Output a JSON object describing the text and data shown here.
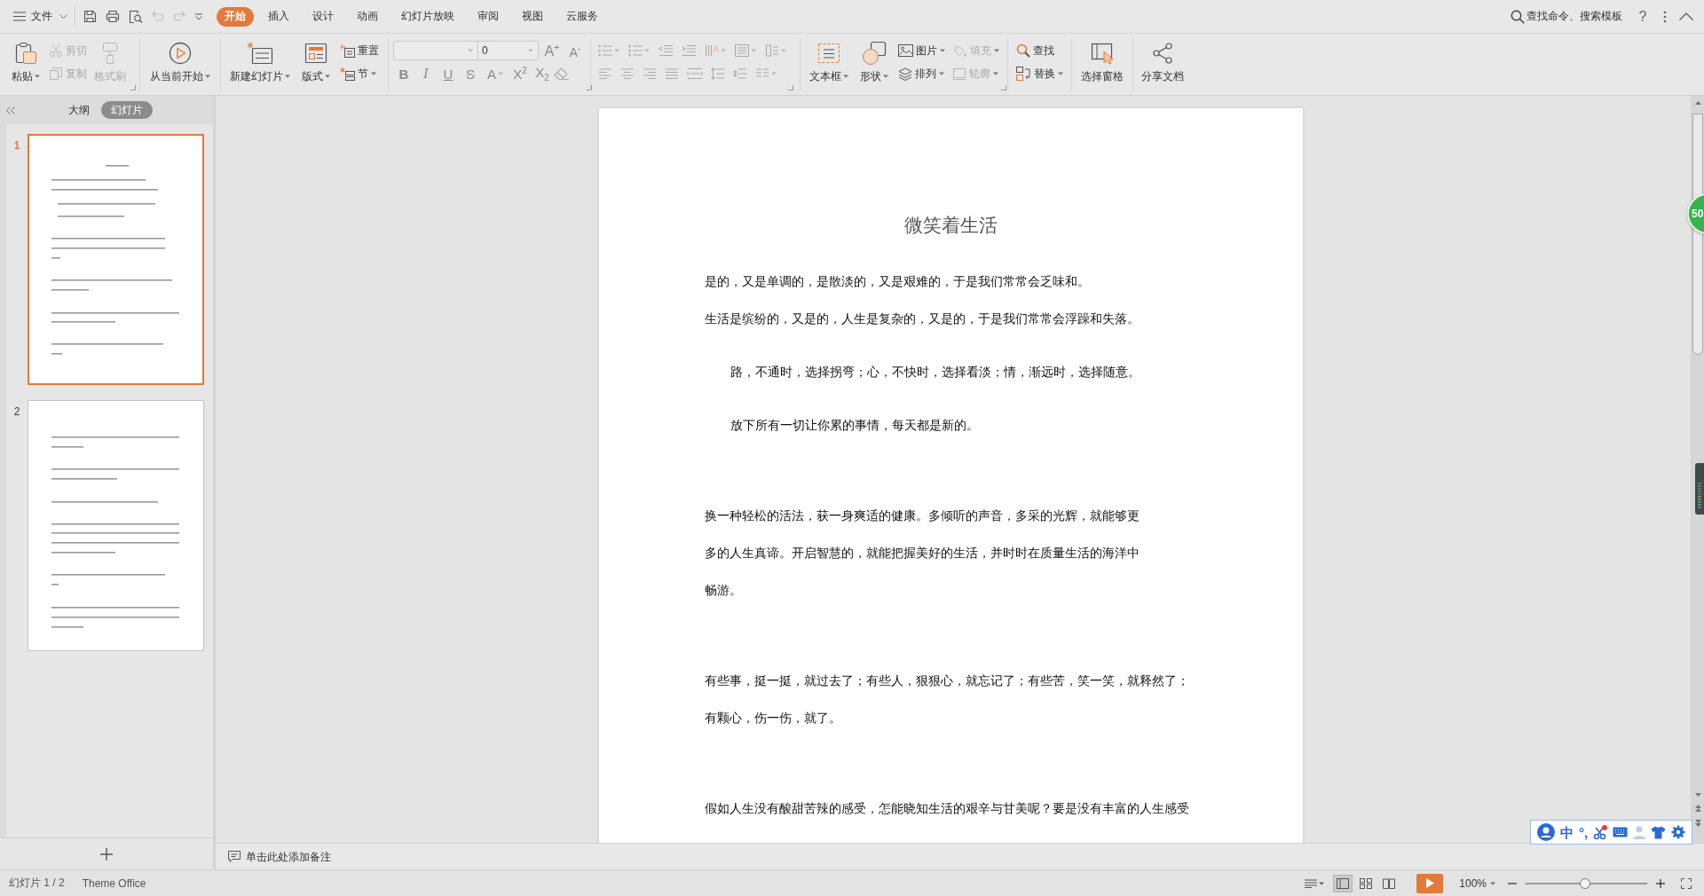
{
  "menu_bar": {
    "file_menu": "文件",
    "tabs": [
      {
        "label": "开始",
        "selected": true
      },
      {
        "label": "插入",
        "selected": false
      },
      {
        "label": "设计",
        "selected": false
      },
      {
        "label": "动画",
        "selected": false
      },
      {
        "label": "幻灯片放映",
        "selected": false
      },
      {
        "label": "审阅",
        "selected": false
      },
      {
        "label": "视图",
        "selected": false
      },
      {
        "label": "云服务",
        "selected": false
      }
    ],
    "search": "查找命令、搜索模板",
    "help": "?"
  },
  "ribbon": {
    "paste": {
      "label": "粘贴",
      "disabled": false
    },
    "cut": {
      "label": "剪切",
      "disabled": true
    },
    "copy": {
      "label": "复制",
      "disabled": true
    },
    "format_painter": {
      "label": "格式刷",
      "disabled": true
    },
    "play_from_current": {
      "label": "从当前开始",
      "disabled": false
    },
    "new_slide": {
      "label": "新建幻灯片",
      "disabled": false
    },
    "layout": {
      "label": "版式",
      "disabled": false
    },
    "reset": {
      "label": "重置",
      "disabled": false
    },
    "section": {
      "label": "节",
      "disabled": false
    },
    "font_size": {
      "value": "0"
    },
    "size_buttons": [
      {
        "kind": "grow",
        "label": "A$^{+}$",
        "disabled": true
      },
      {
        "kind": "shrink",
        "label": "A$^{-}$",
        "disabled": true
      }
    ],
    "format_buttons": [
      {
        "kind": "bold",
        "label": "B",
        "disabled": true
      },
      {
        "kind": "italic",
        "label": "I",
        "disabled": true
      },
      {
        "kind": "underline",
        "label": "U",
        "disabled": true
      },
      {
        "kind": "strike",
        "label": "S",
        "disabled": true
      },
      {
        "kind": "color",
        "label": "A",
        "disabled": true
      },
      {
        "kind": "superscript",
        "label": "X$^{2}$",
        "disabled": true
      },
      {
        "kind": "subscript",
        "label": "X$_{2}$",
        "disabled": true
      }
    ],
    "text_box": {
      "label": "文本框",
      "disabled": false
    },
    "shape": {
      "label": "形状",
      "disabled": false
    },
    "picture": {
      "label": "图片",
      "disabled": false
    },
    "arrange": {
      "label": "排列",
      "disabled": false
    },
    "fill": {
      "label": "填充",
      "disabled": true
    },
    "outline": {
      "label": "轮廓",
      "disabled": true
    },
    "find": {
      "label": "查找",
      "disabled": false
    },
    "replace": {
      "label": "替换",
      "disabled": false
    },
    "selection_pane": {
      "label": "选择窗格",
      "disabled": false
    },
    "share": {
      "label": "分享文档",
      "disabled": false
    }
  },
  "left_panel": {
    "tabs": [
      {
        "label": "大纲",
        "selected": false
      },
      {
        "label": "幻灯片",
        "selected": true
      }
    ],
    "slides": [
      {
        "number": "1",
        "selected": true
      },
      {
        "number": "2",
        "selected": false
      }
    ]
  },
  "slide": {
    "title": "微笑着生活",
    "sections": [
      {
        "paragraphs": [
          {
            "indented": false,
            "lines": [
              "是的，又是单调的，是散淡的，又是艰难的，于是我们常常会乏味和。"
            ]
          },
          {
            "indented": false,
            "lines": [
              "生活是缤纷的，又是的，人生是复杂的，又是的，于是我们常常会浮躁和失落。"
            ]
          },
          {
            "indented": true,
            "lines": [
              "路，不通时，选择拐弯；心，不快时，选择看淡；情，渐远时，选择随意。"
            ]
          },
          {
            "indented": true,
            "lines": [
              "放下所有一切让你累的事情，每天都是新的。"
            ]
          }
        ]
      },
      {
        "paragraphs": [
          {
            "indented": false,
            "lines": [
              "换一种轻松的活法，获一身爽适的健康。多倾听的声音，多采的光辉，就能够更",
              "多的人生真谛。开启智慧的，就能把握美好的生活，并时时在质量生活的海洋中",
              "畅游。"
            ]
          }
        ]
      },
      {
        "paragraphs": [
          {
            "indented": false,
            "lines": [
              "有些事，挺一挺，就过去了；有些人，狠狠心，就忘记了；有些苦，笑一笑，就释然了；",
              "有颗心，伤一伤，就了。"
            ]
          }
        ]
      },
      {
        "paragraphs": [
          {
            "indented": false,
            "lines": [
              "假如人生没有酸甜苦辣的感受，怎能晓知生活的艰辛与甘美呢？要是没有丰富的人生感受"
            ]
          }
        ]
      }
    ]
  },
  "notes": {
    "placeholder": "单击此处添加备注"
  },
  "status_bar": {
    "slide_counter": "幻灯片 1 / 2",
    "theme": "Theme Office",
    "views": [
      {
        "kind": "normal",
        "selected": true
      },
      {
        "kind": "sorter",
        "selected": false
      },
      {
        "kind": "reading",
        "selected": false
      }
    ],
    "zoom": {
      "value": "100%",
      "level": 0.49
    }
  },
  "side_badge": "50",
  "ime_toolbar": {
    "mode": "中",
    "punctuation": "°,"
  }
}
